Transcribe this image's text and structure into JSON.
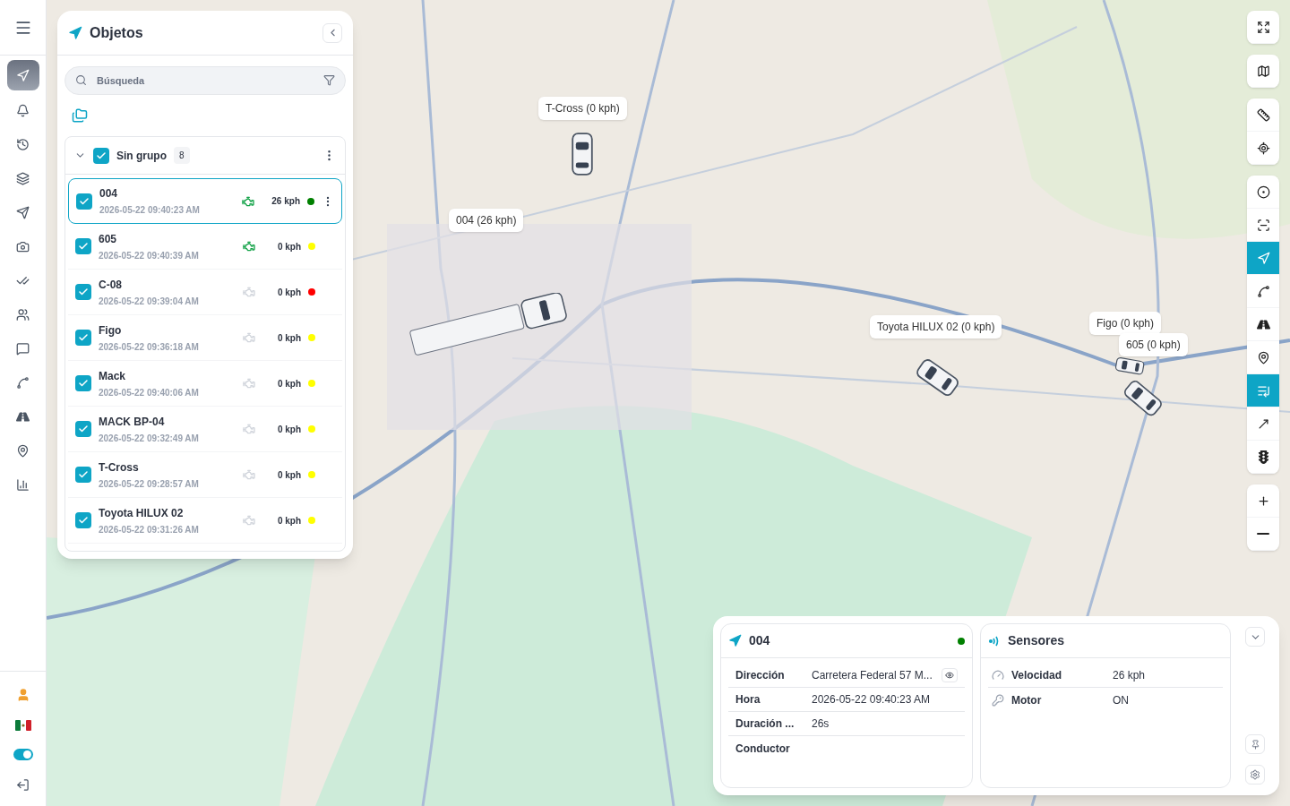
{
  "sidebar": {
    "items": [
      {
        "kind": "navigate",
        "selected": true
      },
      {
        "kind": "bell",
        "selected": false
      },
      {
        "kind": "history",
        "selected": false
      },
      {
        "kind": "layers",
        "selected": false
      },
      {
        "kind": "send",
        "selected": false
      },
      {
        "kind": "camera",
        "selected": false
      },
      {
        "kind": "checks",
        "selected": false
      },
      {
        "kind": "users",
        "selected": false
      },
      {
        "kind": "chat",
        "selected": false
      },
      {
        "kind": "route",
        "selected": false
      },
      {
        "kind": "road",
        "selected": false
      },
      {
        "kind": "pin",
        "selected": false
      },
      {
        "kind": "chart",
        "selected": false
      }
    ],
    "dark_mode": {
      "on": true
    }
  },
  "objects_panel": {
    "title": "Objetos",
    "search": {
      "placeholder": "Búsqueda"
    },
    "group": {
      "name": "Sin grupo",
      "count": "8",
      "checked": true,
      "expanded": true
    },
    "objects": [
      {
        "name": "004",
        "time": "2026-05-22 09:40:23 AM",
        "speed": "26 kph",
        "engine_on": true,
        "color": "#008000",
        "checked": true,
        "selected": true
      },
      {
        "name": "605",
        "time": "2026-05-22 09:40:39 AM",
        "speed": "0 kph",
        "engine_on": true,
        "color": "#ffff00",
        "checked": true,
        "selected": false
      },
      {
        "name": "C-08",
        "time": "2026-05-22 09:39:04 AM",
        "speed": "0 kph",
        "engine_on": false,
        "color": "#ff0000",
        "checked": true,
        "selected": false
      },
      {
        "name": "Figo",
        "time": "2026-05-22 09:36:18 AM",
        "speed": "0 kph",
        "engine_on": false,
        "color": "#ffff00",
        "checked": true,
        "selected": false
      },
      {
        "name": "Mack",
        "time": "2026-05-22 09:40:06 AM",
        "speed": "0 kph",
        "engine_on": false,
        "color": "#ffff00",
        "checked": true,
        "selected": false
      },
      {
        "name": "MACK BP-04",
        "time": "2026-05-22 09:32:49 AM",
        "speed": "0 kph",
        "engine_on": false,
        "color": "#ffff00",
        "checked": true,
        "selected": false
      },
      {
        "name": "T-Cross",
        "time": "2026-05-22 09:28:57 AM",
        "speed": "0 kph",
        "engine_on": false,
        "color": "#ffff00",
        "checked": true,
        "selected": false
      },
      {
        "name": "Toyota HILUX 02",
        "time": "2026-05-22 09:31:26 AM",
        "speed": "0 kph",
        "engine_on": false,
        "color": "#ffff00",
        "checked": true,
        "selected": false
      }
    ]
  },
  "map": {
    "vehicle_labels": [
      "T-Cross (0 kph)",
      "004 (26 kph)",
      "Toyota HILUX 02 (0 kph)",
      "Figo (0 kph)",
      "605 (0 kph)"
    ]
  },
  "map_tools": [
    {
      "kind": "fullscreen",
      "selected": false
    },
    {
      "kind": "map",
      "selected": false
    },
    {
      "kind": "ruler",
      "selected": false
    },
    {
      "kind": "locate",
      "selected": false
    },
    {
      "kind": "record",
      "selected": false
    },
    {
      "kind": "focus",
      "selected": false
    },
    {
      "kind": "navigate",
      "selected": true
    },
    {
      "kind": "route",
      "selected": false
    },
    {
      "kind": "road",
      "selected": false
    },
    {
      "kind": "pin",
      "selected": false
    },
    {
      "kind": "list",
      "selected": true
    },
    {
      "kind": "arrow",
      "selected": false
    },
    {
      "kind": "traffic",
      "selected": false
    },
    {
      "kind": "zoom_in",
      "selected": false
    },
    {
      "kind": "zoom_out",
      "selected": false
    }
  ],
  "details": {
    "title": "004",
    "color": "#008000",
    "rows": [
      {
        "label": "Dirección",
        "value": "Carretera Federal 57 M..."
      },
      {
        "label": "Hora",
        "value": "2026-05-22 09:40:23 AM"
      },
      {
        "label": "Duración ...",
        "value": "26s"
      },
      {
        "label": "Conductor",
        "value": ""
      }
    ],
    "sensors": {
      "title": "Sensores",
      "rows": [
        {
          "kind": "speed",
          "label": "Velocidad",
          "value": "26 kph"
        },
        {
          "kind": "key",
          "label": "Motor",
          "value": "ON"
        }
      ]
    }
  }
}
